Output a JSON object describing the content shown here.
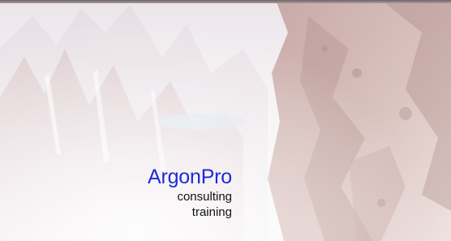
{
  "brand": {
    "name": "ArgonPro",
    "lines": [
      "consulting",
      "training"
    ]
  },
  "colors": {
    "brand_blue": "#1f2ad6",
    "rock": "#b89a98",
    "sky": "#f2eef1"
  },
  "images": {
    "hero": "mountain-rocks-photo"
  }
}
